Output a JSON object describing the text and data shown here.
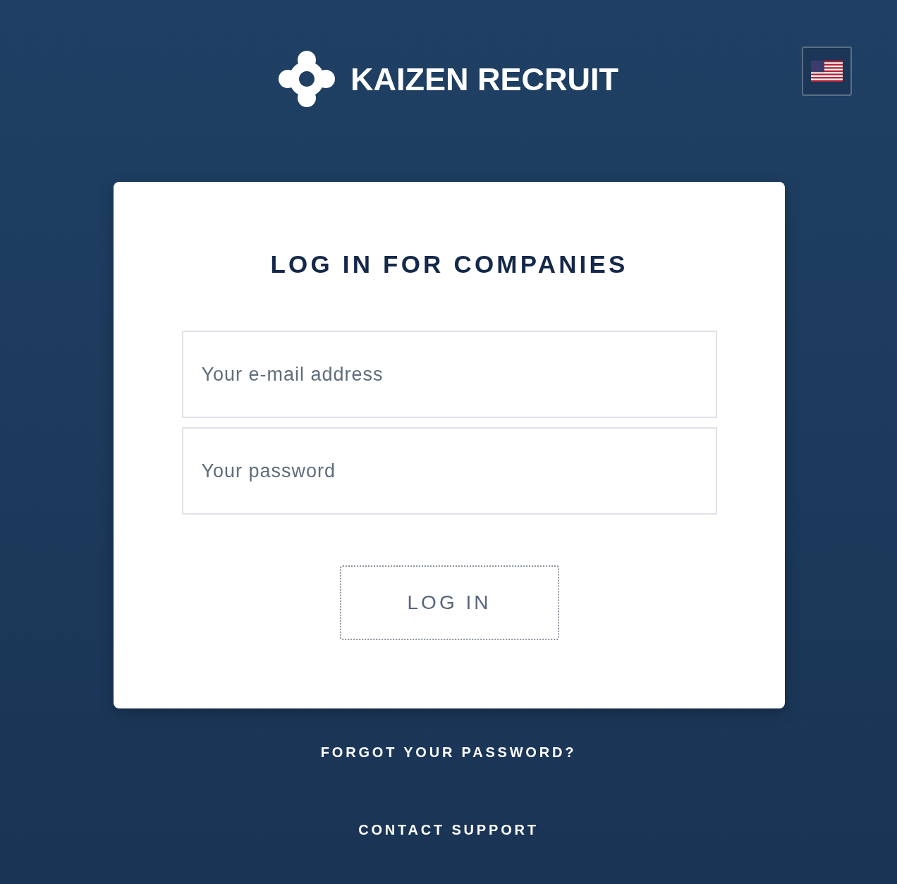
{
  "header": {
    "brand": "KAIZEN RECRUIT"
  },
  "login_card": {
    "title": "LOG IN FOR COMPANIES",
    "fields": [
      {
        "placeholder": "Your e-mail address"
      },
      {
        "placeholder": "Your password"
      }
    ],
    "submit_button": {
      "label": "LOG IN",
      "focused": true
    }
  },
  "links": [
    "FORGOT YOUR PASSWORD?",
    "CONTACT SUPPORT"
  ]
}
